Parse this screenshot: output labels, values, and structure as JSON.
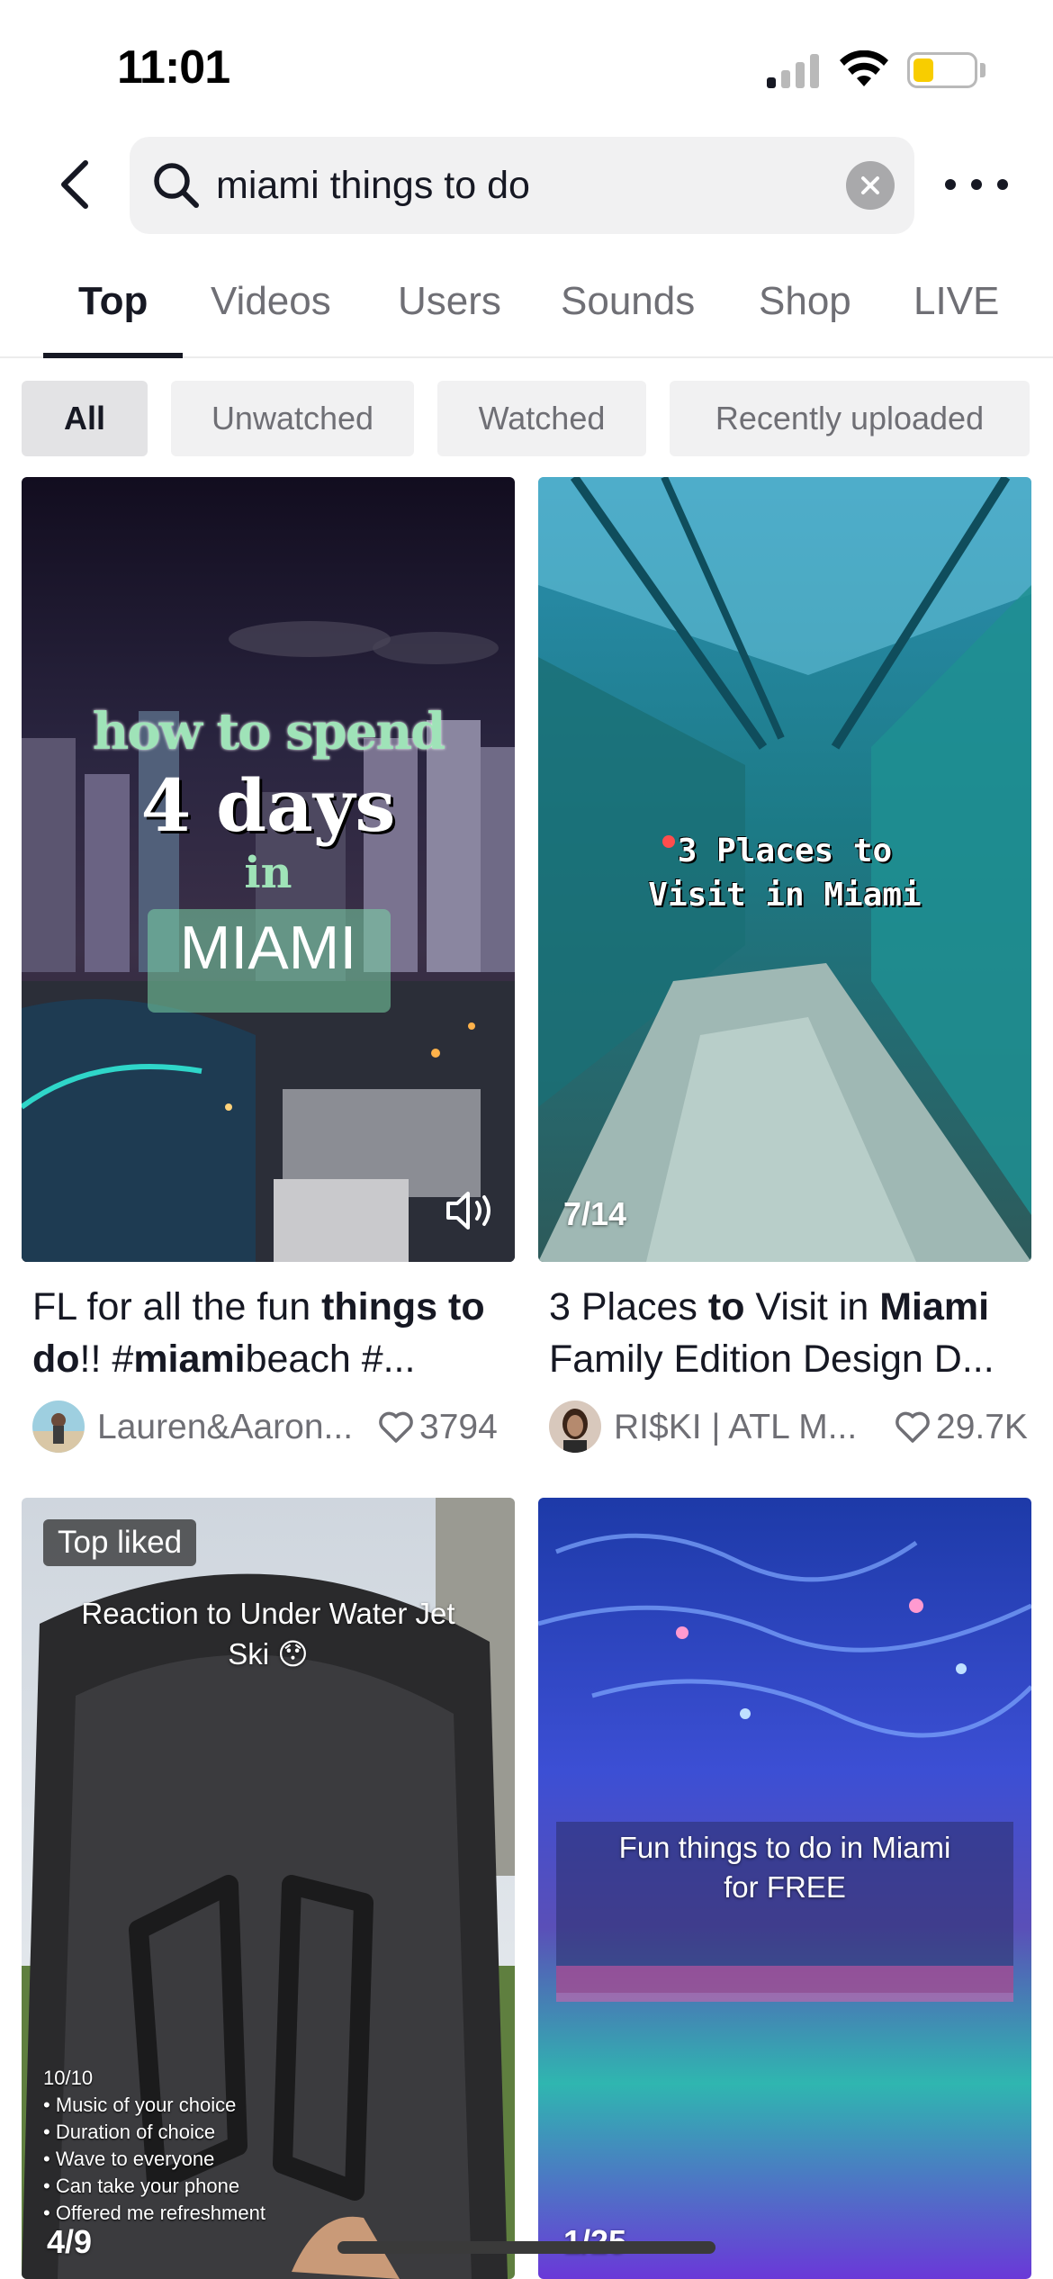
{
  "status_bar": {
    "time": "11:01"
  },
  "search": {
    "query": "miami things to do"
  },
  "tabs": [
    {
      "label": "Top"
    },
    {
      "label": "Videos"
    },
    {
      "label": "Users"
    },
    {
      "label": "Sounds"
    },
    {
      "label": "Shop"
    },
    {
      "label": "LIVE"
    }
  ],
  "filters": [
    {
      "label": "All"
    },
    {
      "label": "Unwatched"
    },
    {
      "label": "Watched"
    },
    {
      "label": "Recently uploaded"
    }
  ],
  "cards": [
    {
      "overlay": {
        "line1": "how to spend",
        "line2": "4 days",
        "line3": "in",
        "line4": "MIAMI"
      },
      "title_parts": [
        "FL for all the fun ",
        "things",
        " ",
        "to do",
        "!! #",
        "miami",
        "beach #..."
      ],
      "author": "Lauren&Aaron...",
      "likes": "3794"
    },
    {
      "overlay": {
        "line1": "3 Places to",
        "line2": "Visit in Miami"
      },
      "counter": "7/14",
      "title_parts": [
        "3 Places ",
        "to",
        " Visit in ",
        "Miami",
        " Family Edition Design D..."
      ],
      "author": "RI$KI | ATL M...",
      "likes": "29.7K"
    },
    {
      "badge": "Top liked",
      "overlay": {
        "line1": "Reaction to Under Water Jet",
        "line2": "Ski 😯"
      },
      "list": [
        "10/10",
        "• Music of your choice",
        "• Duration of choice",
        "• Wave to everyone",
        "• Can take your phone",
        "• Offered me refreshment"
      ],
      "counter": "4/9"
    },
    {
      "overlay": {
        "line1": "Fun things to do in Miami",
        "line2": "for FREE"
      },
      "counter": "1/25"
    }
  ]
}
